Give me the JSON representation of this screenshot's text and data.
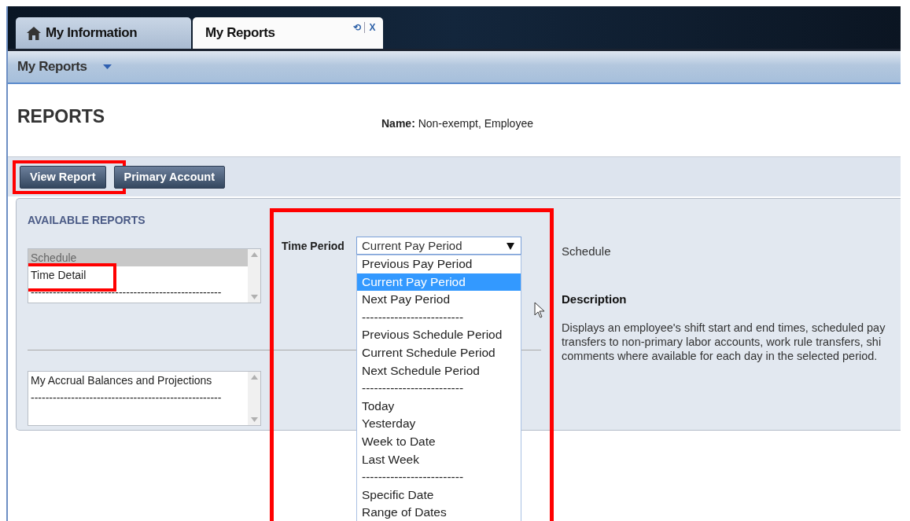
{
  "tabs": [
    {
      "label": "My Information",
      "kind": "home",
      "selected": false
    },
    {
      "label": "My Reports",
      "kind": "report",
      "selected": true,
      "refresh": "⟲",
      "close": "X"
    }
  ],
  "toolbar": {
    "menu": "My Reports"
  },
  "page_title": "REPORTS",
  "name": {
    "label": "Name:",
    "value": "Non-exempt, Employee"
  },
  "buttons": [
    {
      "label": "View Report",
      "highlighted": true
    },
    {
      "label": "Primary Account",
      "highlighted": false
    }
  ],
  "available_reports": {
    "heading": "AVAILABLE REPORTS",
    "lists": [
      {
        "items": [
          {
            "label": "Schedule",
            "selected": true,
            "highlighted": false
          },
          {
            "label": "Time Detail",
            "selected": false,
            "highlighted": true
          },
          {
            "label": "----------------------------------------------------",
            "selected": false,
            "highlighted": false
          }
        ]
      },
      {
        "items": [
          {
            "label": "My Accrual Balances and Projections",
            "selected": false,
            "highlighted": false
          },
          {
            "label": "----------------------------------------------------",
            "selected": false,
            "highlighted": false
          }
        ]
      }
    ]
  },
  "time_period": {
    "label": "Time Period",
    "value": "Current Pay Period",
    "highlighted": true,
    "options": [
      {
        "label": "Previous Pay Period",
        "selected": false
      },
      {
        "label": "Current Pay Period",
        "selected": true
      },
      {
        "label": "Next Pay Period",
        "selected": false
      },
      {
        "label": "-------------------------",
        "selected": false
      },
      {
        "label": "Previous Schedule Period",
        "selected": false
      },
      {
        "label": "Current Schedule Period",
        "selected": false
      },
      {
        "label": "Next Schedule Period",
        "selected": false
      },
      {
        "label": "-------------------------",
        "selected": false
      },
      {
        "label": "Today",
        "selected": false
      },
      {
        "label": "Yesterday",
        "selected": false
      },
      {
        "label": "Week to Date",
        "selected": false
      },
      {
        "label": "Last Week",
        "selected": false
      },
      {
        "label": "-------------------------",
        "selected": false
      },
      {
        "label": "Specific Date",
        "selected": false
      },
      {
        "label": "Range of Dates",
        "selected": false
      }
    ]
  },
  "report_detail": {
    "title": "Schedule",
    "description_heading": "Description",
    "description_lines": [
      "Displays an employee's shift start and end times, scheduled pay",
      "transfers to non-primary labor accounts, work rule transfers, shi",
      "comments where available for each day in the selected period."
    ]
  }
}
